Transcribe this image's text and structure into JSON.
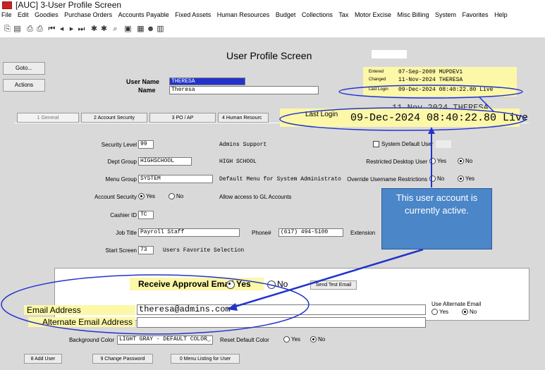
{
  "window": {
    "title": "[AUC] 3-User Profile Screen"
  },
  "menu": [
    "File",
    "Edit",
    "Goodies",
    "Purchase Orders",
    "Accounts Payable",
    "Fixed Assets",
    "Human Resources",
    "Budget",
    "Collections",
    "Tax",
    "Motor Excise",
    "Misc Billing",
    "System",
    "Favorites",
    "Help"
  ],
  "screen": {
    "title": "User Profile Screen"
  },
  "side_buttons": {
    "goto": "Goto...",
    "actions": "Actions"
  },
  "user": {
    "name_label": "User Name",
    "name_value": "THERESA",
    "fullname_label": "Name",
    "fullname_value": "Theresa"
  },
  "audit": {
    "entered_label": "Entered",
    "entered_value": "07-Sep-2009 MUPDEV1",
    "changed_label": "Changed",
    "changed_value": "11-Nov-2024 THERESA",
    "lastlogin_label": "Last Login",
    "lastlogin_value": "09-Dec-2024 08:40:22.80 Live"
  },
  "zoom": {
    "behind_text": "11-Nov-2024 THERESA",
    "label": "Last Login",
    "value": "09-Dec-2024 08:40:22.80 Live"
  },
  "tabs": [
    "1 General",
    "2 Account Security",
    "3 PO / AP",
    "4 Human Resourc"
  ],
  "general": {
    "security_level_label": "Security Level",
    "security_level_value": "99",
    "security_level_desc": "Admins Support",
    "dept_group_label": "Dept Group",
    "dept_group_value": "HIGHSCHOOL",
    "dept_group_desc": "HIGH SCHOOL",
    "menu_group_label": "Menu Group",
    "menu_group_value": "SYSTEM",
    "menu_group_desc": "Default Menu for System Administrato",
    "account_security_label": "Account Security",
    "yes": "Yes",
    "no": "No",
    "account_security_desc": "Allow access to GL Accounts",
    "cashier_label": "Cashier ID",
    "cashier_value": "TC",
    "job_title_label": "Job Title",
    "job_title_value": "Payroll Staff",
    "phone_label": "Phone#",
    "phone_value": "(617) 494-5100",
    "extension_label": "Extension",
    "start_screen_label": "Start Screen",
    "start_screen_value": "73",
    "start_screen_desc": "Users Favorite Selection",
    "system_default_label": "System Default User",
    "restricted_label": "Restricted Desktop User",
    "override_label": "Override Username Restrictions"
  },
  "callout": {
    "text": "This user account is currently active."
  },
  "email": {
    "receive_label": "Receive Approval Email",
    "yes": "Yes",
    "no": "No",
    "send_test": "Send Test Email",
    "address_label": "Email Address",
    "address_value": "theresa@admins.com",
    "alt_label": "Alternate Email Address",
    "use_alt_label": "Use Alternate Email"
  },
  "background": {
    "label": "Background Color",
    "value": "LIGHT GRAY - DEFAULT COLOR",
    "reset_label": "Reset Default Color",
    "yes": "Yes",
    "no": "No"
  },
  "bottom_buttons": [
    "8 Add User",
    "9 Change Password",
    "0 Menu Listing for User"
  ],
  "colors": {
    "panel": "#d9d9d9",
    "highlight": "#fdf7a8",
    "accent": "#2233cc",
    "callout": "#4a86c8"
  }
}
